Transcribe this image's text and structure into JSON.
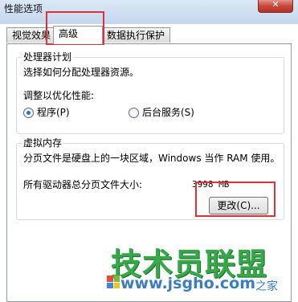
{
  "window": {
    "title": "性能选项"
  },
  "tabs": [
    {
      "label": "视觉效果"
    },
    {
      "label": "高级"
    },
    {
      "label": "数据执行保护"
    }
  ],
  "processor_schedule": {
    "title": "处理器计划",
    "description": "选择如何分配处理器资源。",
    "adjust_label": "调整以优化性能:",
    "options": [
      {
        "label": "程序(P)",
        "checked": true
      },
      {
        "label": "后台服务(S)",
        "checked": false
      }
    ]
  },
  "virtual_memory": {
    "title": "虚拟内存",
    "description": "分页文件是硬盘上的一块区域，Windows 当作 RAM 使用。",
    "total_label": "所有驱动器总分页文件大小:",
    "total_value": "3998 MB",
    "change_button": "更改(C)..."
  },
  "watermark": {
    "main": "技术员联盟",
    "url": "www.jsgho.com",
    "home": "之家"
  },
  "colors": {
    "highlight": "#e0313a",
    "watermark_green": "#36a84a",
    "watermark_blue": "#3a7dc4"
  }
}
